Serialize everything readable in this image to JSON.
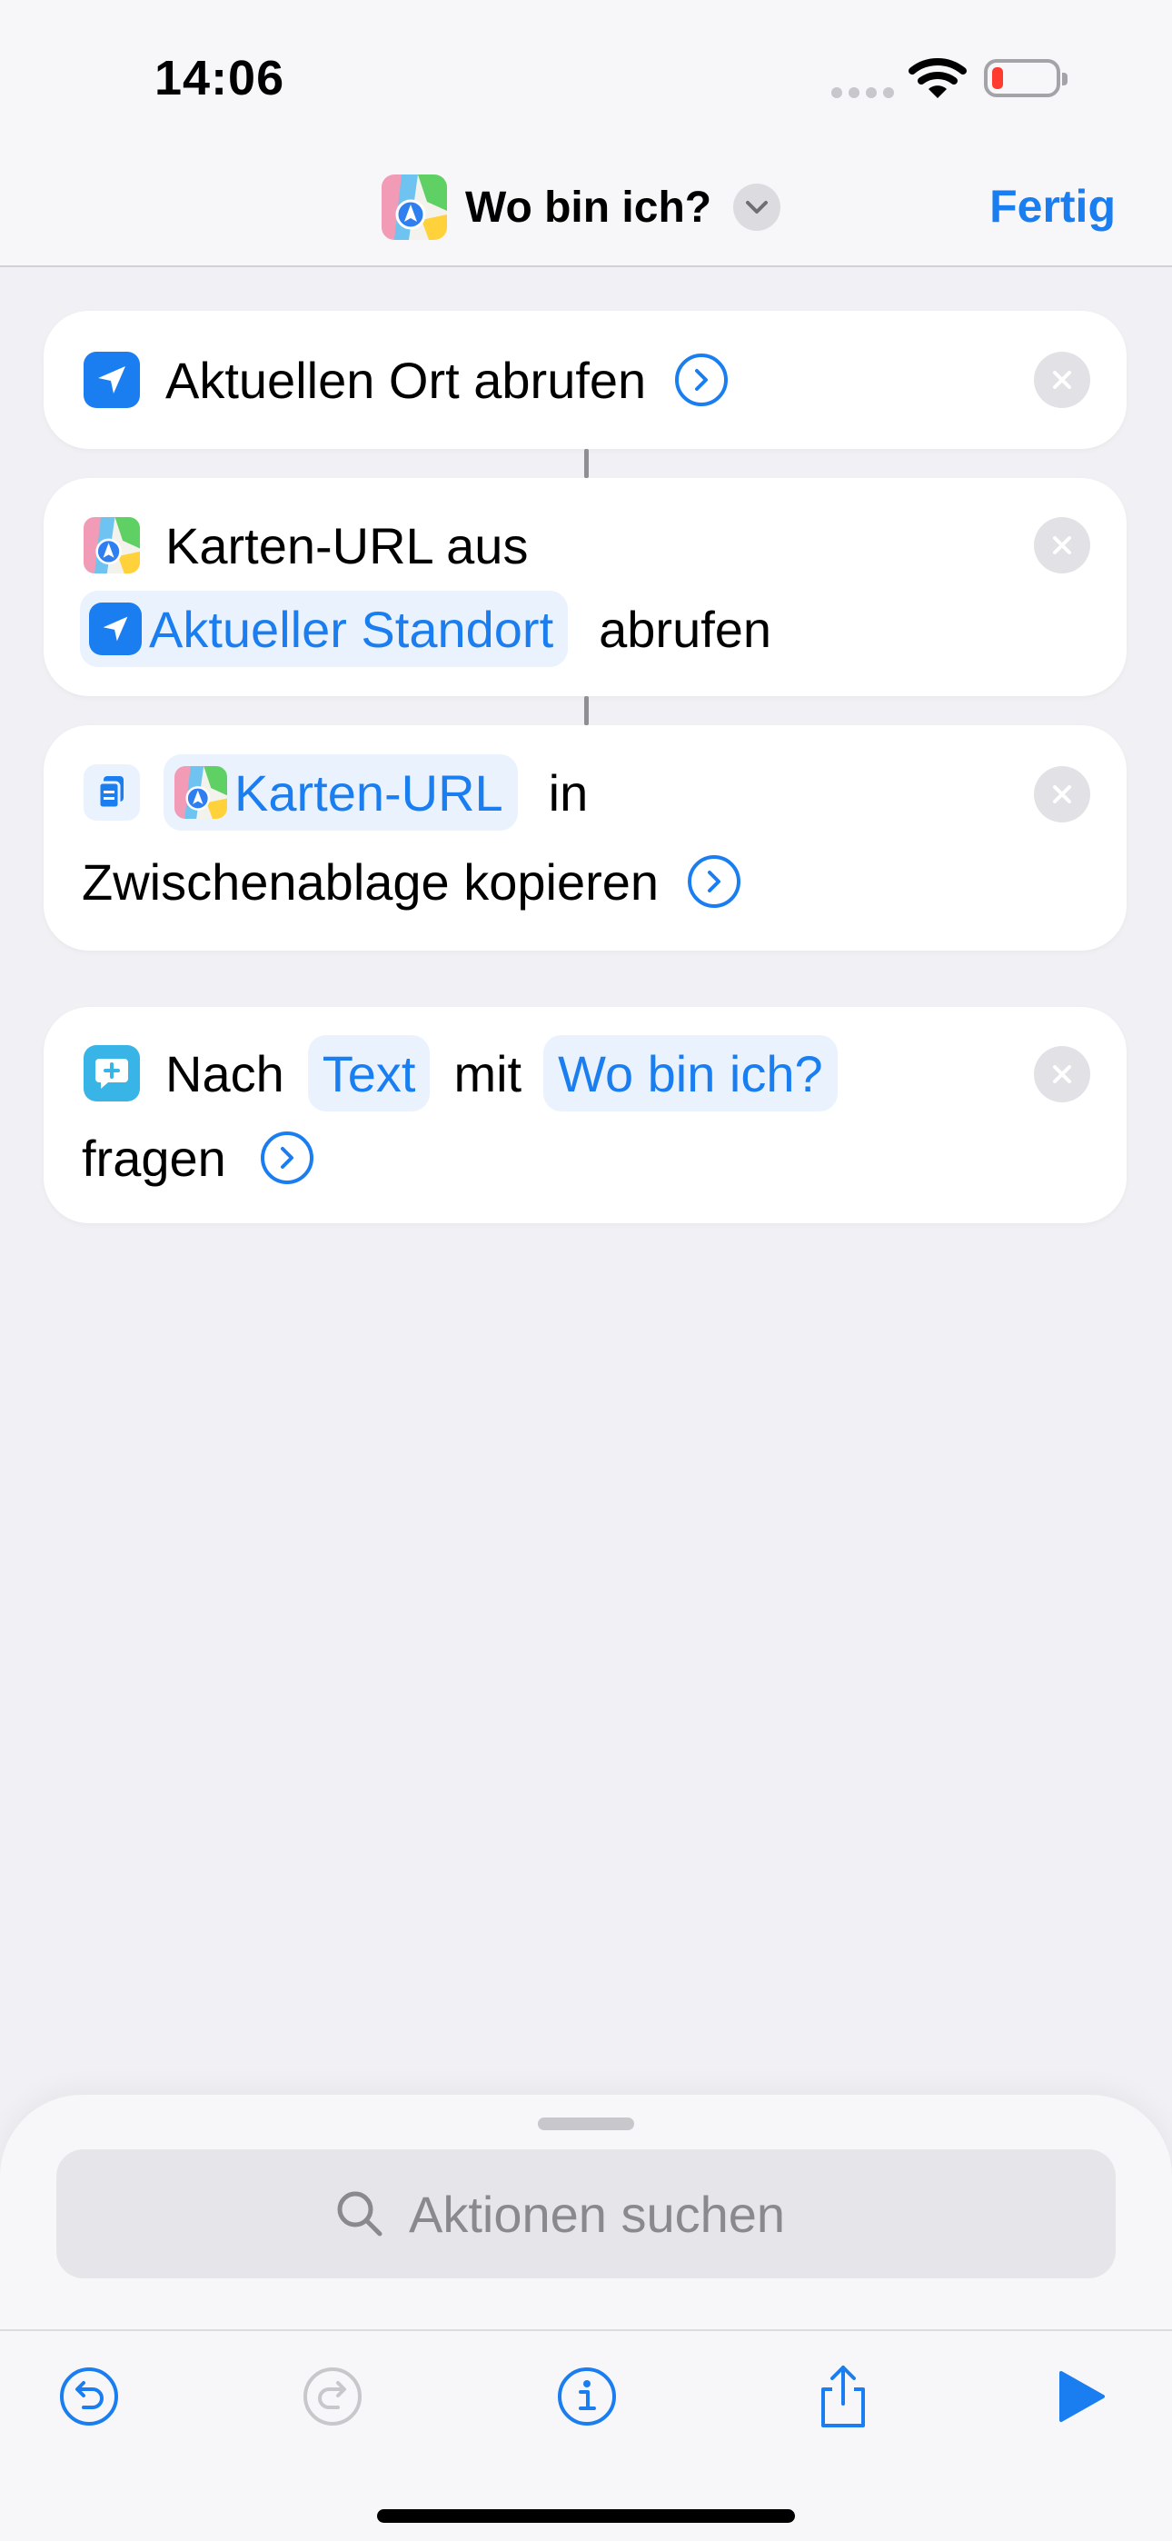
{
  "status_bar": {
    "time": "14:06"
  },
  "nav": {
    "title": "Wo bin ich?",
    "done_label": "Fertig"
  },
  "actions": [
    {
      "text": "Aktuellen Ort abrufen"
    },
    {
      "text_before": "Karten-URL aus",
      "token": "Aktueller Standort",
      "text_after": "abrufen"
    },
    {
      "token": "Karten-URL",
      "text_mid": "in",
      "text_line2": "Zwischenablage kopieren"
    },
    {
      "text_before": "Nach",
      "token_1": "Text",
      "text_mid": "mit",
      "token_2": "Wo bin ich?",
      "text_line2": "fragen"
    }
  ],
  "search": {
    "placeholder": "Aktionen suchen"
  },
  "colors": {
    "accent": "#1a7ef0",
    "background": "#f1f1f5",
    "card": "#ffffff"
  },
  "icons": {
    "nav": "maps-app-icon",
    "action_1": "location-arrow-icon",
    "action_2": "maps-app-icon",
    "action_3": "clipboard-icon",
    "action_4": "ask-message-icon",
    "toolbar": [
      "undo-icon",
      "redo-icon",
      "info-icon",
      "share-icon",
      "play-icon"
    ]
  }
}
